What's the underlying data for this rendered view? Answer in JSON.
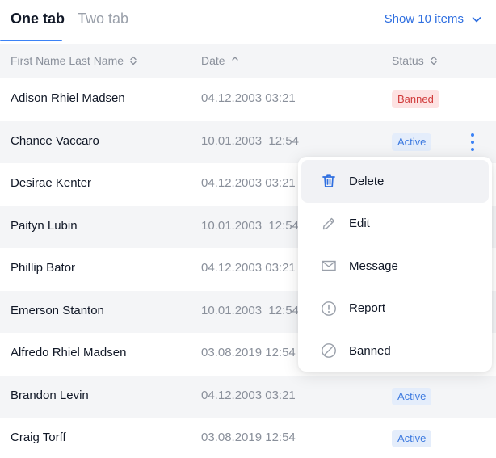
{
  "tabs": [
    {
      "label": "One tab",
      "active": true
    },
    {
      "label": "Two tab",
      "active": false
    }
  ],
  "show_items": {
    "label": "Show 10 items"
  },
  "columns": {
    "name": "First Name Last Name",
    "date": "Date",
    "status": "Status"
  },
  "rows": [
    {
      "name": "Adison Rhiel Madsen",
      "date": "04.12.2003 03:21",
      "status": "Banned"
    },
    {
      "name": "Chance Vaccaro",
      "date": "10.01.2003  12:54",
      "status": "Active"
    },
    {
      "name": "Desirae Kenter",
      "date": "04.12.2003 03:21",
      "status": ""
    },
    {
      "name": "Paityn Lubin",
      "date": "10.01.2003  12:54",
      "status": ""
    },
    {
      "name": "Phillip Bator",
      "date": "04.12.2003 03:21",
      "status": ""
    },
    {
      "name": "Emerson Stanton",
      "date": "10.01.2003  12:54",
      "status": ""
    },
    {
      "name": "Alfredo Rhiel Madsen",
      "date": "03.08.2019 12:54",
      "status": ""
    },
    {
      "name": "Brandon Levin",
      "date": "04.12.2003 03:21",
      "status": "Active"
    },
    {
      "name": "Craig Torff",
      "date": "03.08.2019 12:54",
      "status": "Active"
    }
  ],
  "menu": {
    "items": [
      {
        "label": "Delete",
        "icon": "trash-icon"
      },
      {
        "label": "Edit",
        "icon": "pencil-icon"
      },
      {
        "label": "Message",
        "icon": "envelope-icon"
      },
      {
        "label": "Report",
        "icon": "alert-circle-icon"
      },
      {
        "label": "Banned",
        "icon": "ban-icon"
      }
    ]
  },
  "colors": {
    "accent": "#3b82f6",
    "banned_bg": "#fde2e2",
    "banned_text": "#d03b3b",
    "active_bg": "#e4edfb",
    "active_text": "#3f7be0"
  }
}
